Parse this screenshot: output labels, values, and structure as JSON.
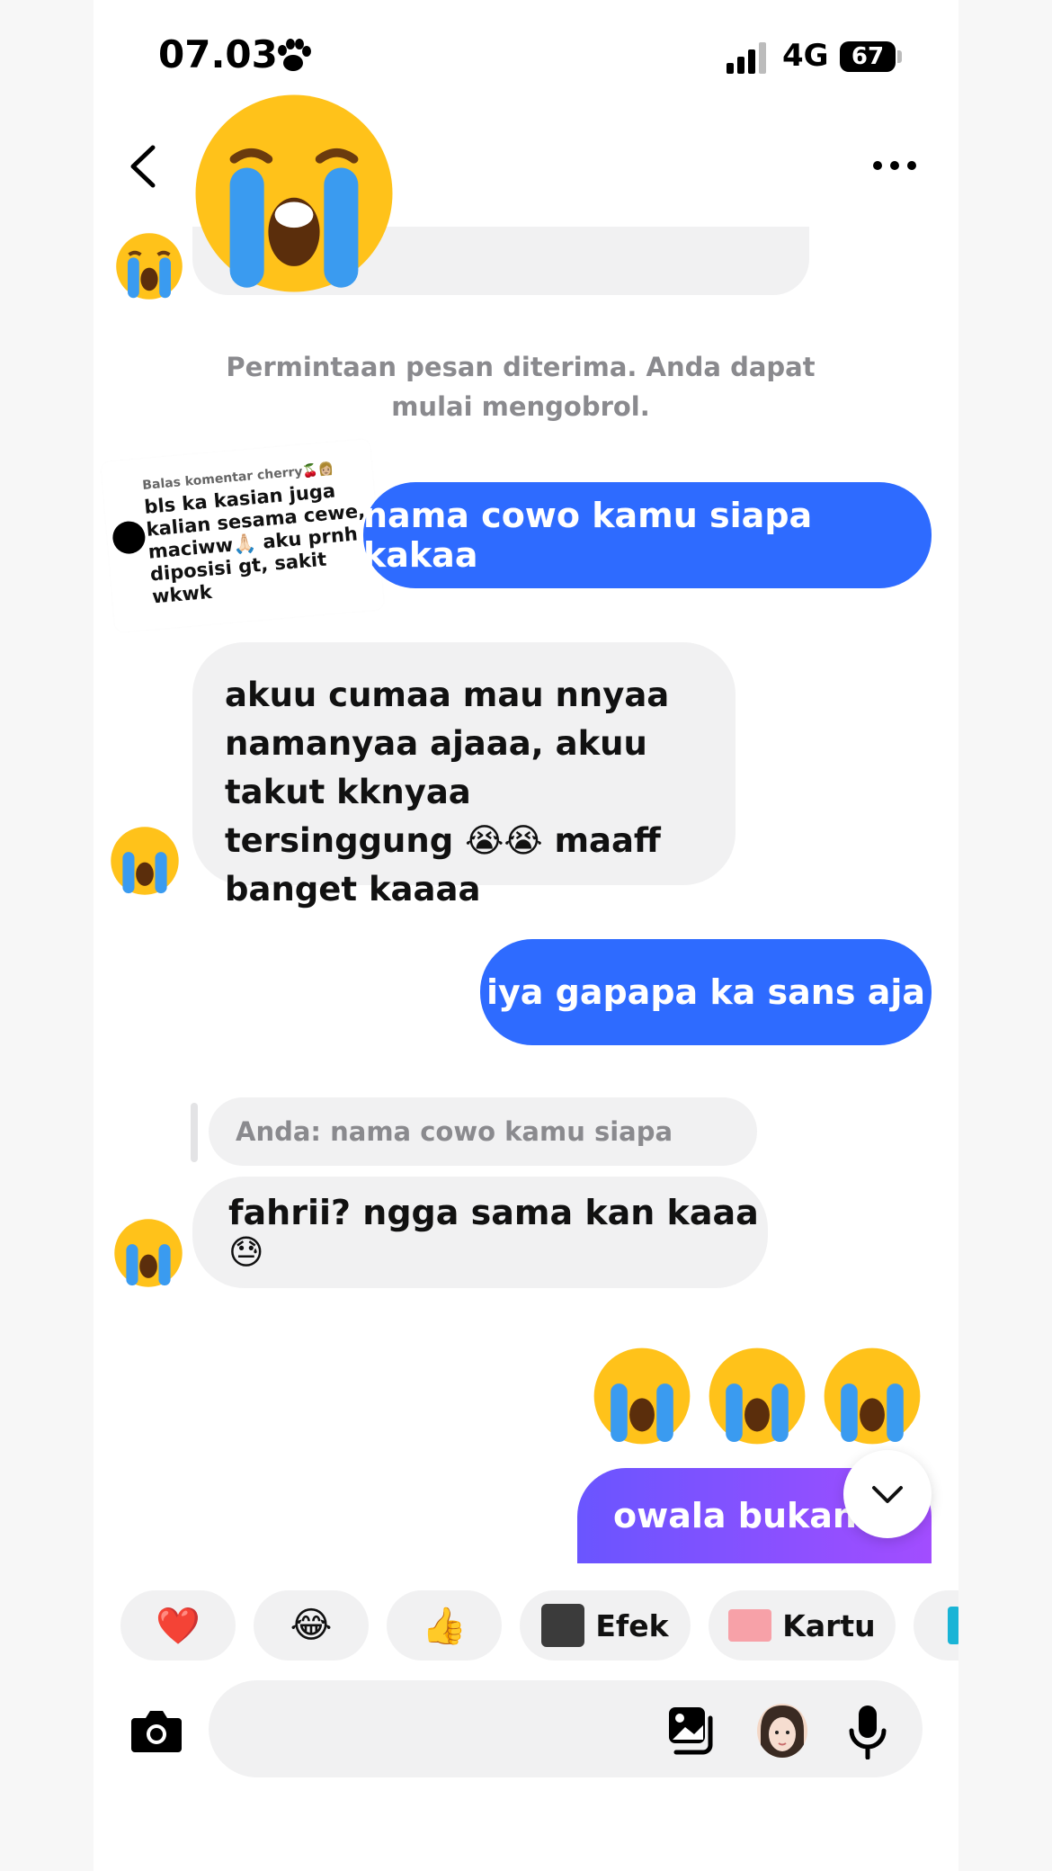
{
  "status_bar": {
    "time": "07.03",
    "network": "4G",
    "battery": "67"
  },
  "system_message": "Permintaan pesan diterima. Anda dapat mulai mengobrol.",
  "reply_card": {
    "title": "Balas komentar cherry🍒👩🏼",
    "text": "bls ka kasian juga kalian sesama cewe, maciww🙏🏻 aku prnh diposisi gt, sakit wkwk"
  },
  "messages": [
    {
      "side": "out",
      "text": "nama cowo kamu siapa kakaa"
    },
    {
      "side": "in",
      "text": "akuu cumaa mau nnyaa namanyaa ajaaa, akuu takut kknyaa tersinggung 😭😭 maaff banget kaaaa"
    },
    {
      "side": "out",
      "text": "iya gapapa ka sans aja"
    },
    {
      "side": "in",
      "quote": "Anda: nama cowo kamu siapa kak...",
      "text": "fahrii? ngga sama kan kaaa😓"
    },
    {
      "side": "out",
      "text": "owala bukan ka"
    }
  ],
  "quick_actions": [
    {
      "label": "❤️"
    },
    {
      "label": "😂"
    },
    {
      "label": "👍"
    },
    {
      "label": "Efek"
    },
    {
      "label": "Kartu"
    }
  ],
  "colors": {
    "outgoing": "#2e6bff",
    "outgoing_gradient_end": "#a24dff",
    "incoming": "#f1f1f2",
    "system_text": "#8a8a8e"
  }
}
